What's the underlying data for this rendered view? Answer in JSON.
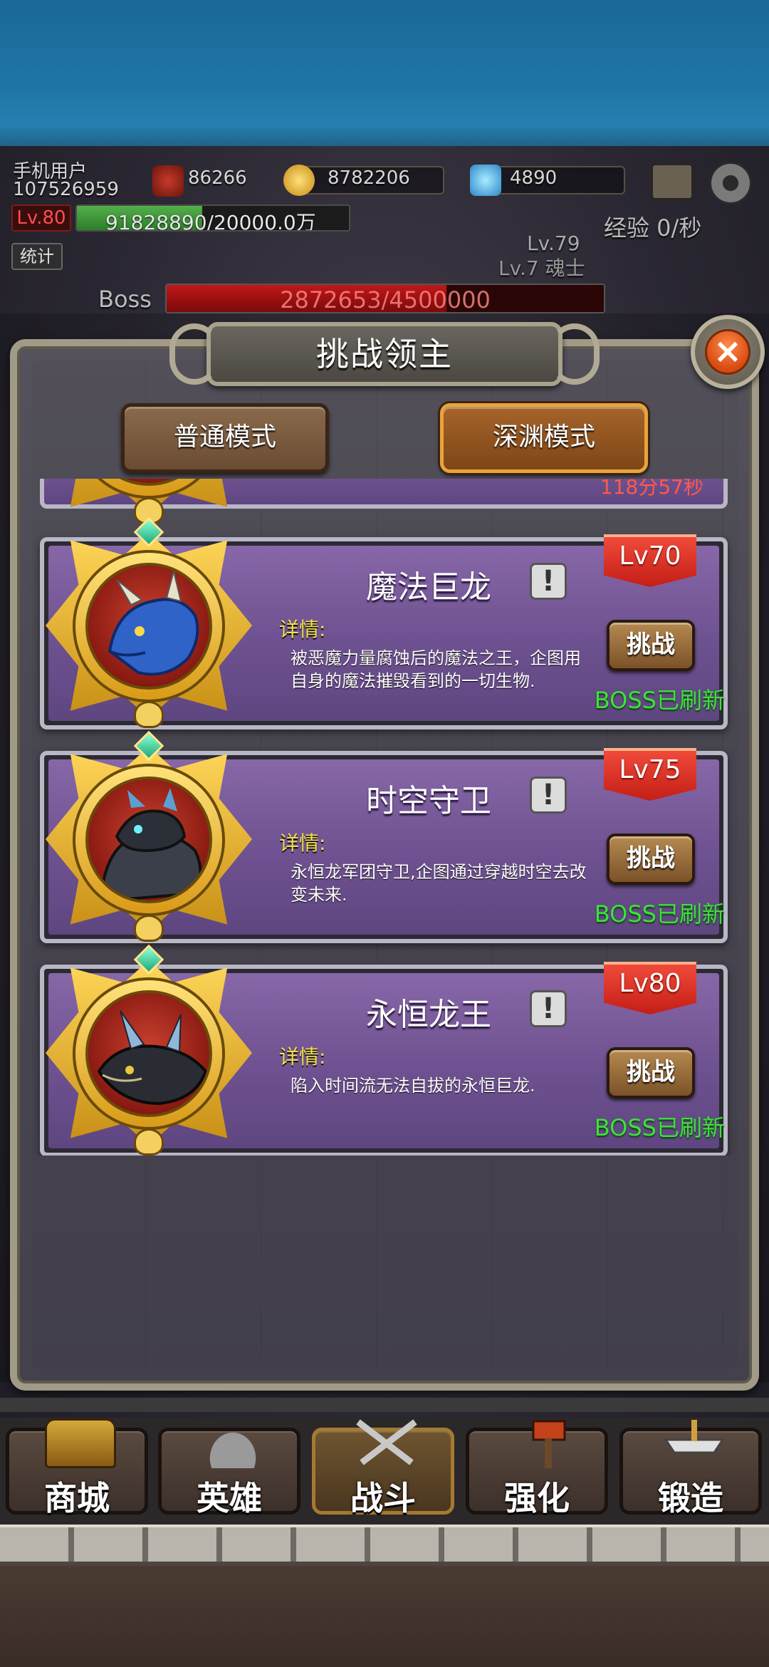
{
  "hud": {
    "user_name": "手机用户",
    "user_id": "107526959",
    "power": "86266",
    "gold": "8782206",
    "gems": "4890",
    "level": "Lv.80",
    "exp_text": "91828890/20000.0万",
    "exp_fraction": 0.46,
    "exp_rate": "经验 0/秒",
    "stats_label": "统计",
    "ghost_level": "Lv.79",
    "ghost_label": "Lv.7 魂士",
    "boss_label": "Boss",
    "boss_hp": "2872653/4500000",
    "boss_fraction": 0.64
  },
  "dialog": {
    "title": "挑战领主",
    "close": "×",
    "tabs": [
      {
        "label": "普通模式",
        "active": false
      },
      {
        "label": "深渊模式",
        "active": true
      }
    ],
    "partial_timer": "118分57秒"
  },
  "bosses": [
    {
      "name": "魔法巨龙",
      "info": "!",
      "detail_label": "详情:",
      "desc": "被恶魔力量腐蚀后的魔法之王，企图用自身的魔法摧毁看到的一切生物.",
      "level": "Lv70",
      "action": "挑战",
      "status": "BOSS已刷新",
      "portrait_icon": "blue-dragon-icon"
    },
    {
      "name": "时空守卫",
      "info": "!",
      "detail_label": "详情:",
      "desc": "永恒龙军团守卫,企图通过穿越时空去改变未来.",
      "level": "Lv75",
      "action": "挑战",
      "status": "BOSS已刷新",
      "portrait_icon": "armored-guard-icon"
    },
    {
      "name": "永恒龙王",
      "info": "!",
      "detail_label": "详情:",
      "desc": "陷入时间流无法自拔的永恒巨龙.",
      "level": "Lv80",
      "action": "挑战",
      "status": "BOSS已刷新",
      "portrait_icon": "dark-dragon-icon"
    }
  ],
  "nav": [
    {
      "label": "商城",
      "icon": "treasure-chest-icon",
      "active": false
    },
    {
      "label": "英雄",
      "icon": "viking-helmet-icon",
      "active": false
    },
    {
      "label": "战斗",
      "icon": "crossed-swords-icon",
      "active": true
    },
    {
      "label": "强化",
      "icon": "hammer-icon",
      "active": false
    },
    {
      "label": "锻造",
      "icon": "anvil-icon",
      "active": false
    }
  ],
  "colors": {
    "card_purple": "#7a5b9c",
    "refresh_green": "#3de13a",
    "level_red": "#d62a1e",
    "detail_yellow": "#f2e14a"
  }
}
